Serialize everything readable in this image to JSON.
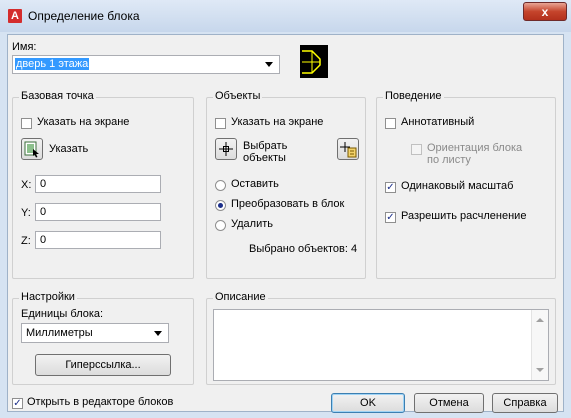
{
  "window": {
    "title": "Определение блока",
    "app_icon_glyph": "A",
    "close_glyph": "x"
  },
  "name": {
    "label": "Имя:",
    "value": "дверь 1 этажа"
  },
  "base_point": {
    "title": "Базовая точка",
    "specify_on_screen": "Указать на экране",
    "pick_button": "Указать",
    "x_label": "X:",
    "x_value": "0",
    "y_label": "Y:",
    "y_value": "0",
    "z_label": "Z:",
    "z_value": "0"
  },
  "objects": {
    "title": "Объекты",
    "specify_on_screen": "Указать на экране",
    "select_objects": "Выбрать объекты",
    "retain": "Оставить",
    "convert_to_block": "Преобразовать в блок",
    "delete": "Удалить",
    "selected_count": "Выбрано объектов: 4"
  },
  "behavior": {
    "title": "Поведение",
    "annotative": "Аннотативный",
    "match_orientation": "Ориентация блока по листу",
    "scale_uniformly": "Одинаковый масштаб",
    "allow_exploding": "Разрешить расчленение"
  },
  "settings": {
    "title": "Настройки",
    "units_label": "Единицы блока:",
    "units_value": "Миллиметры",
    "hyperlink_button": "Гиперссылка..."
  },
  "description": {
    "title": "Описание",
    "value": ""
  },
  "footer": {
    "open_in_editor": "Открыть в редакторе блоков",
    "ok": "OK",
    "cancel": "Отмена",
    "help": "Справка"
  },
  "state": {
    "specify_on_screen_base": false,
    "specify_on_screen_objects": false,
    "retain_selected": false,
    "convert_selected": true,
    "delete_selected": false,
    "annotative": false,
    "match_orientation": false,
    "scale_uniformly": true,
    "allow_exploding": true,
    "open_in_editor": true
  },
  "colors": {
    "accent": "#1c2f8a",
    "selection": "#3399ff",
    "preview_bg": "#000000",
    "preview_fg": "#ffff00",
    "close_button": "#c5442c"
  }
}
